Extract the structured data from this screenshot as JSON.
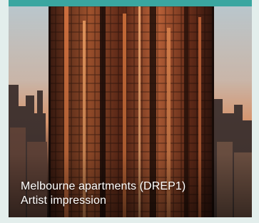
{
  "card": {
    "caption_line1": "Melbourne apartments (DREP1)",
    "caption_line2": "Artist impression",
    "image_subject": "glass-tower-building-photo"
  },
  "colors": {
    "page_background": "#e3eeec",
    "accent_bar": "#3aa6a0",
    "caption_text": "#ffffff",
    "sky_top": "#c9d2d6",
    "sky_horizon": "#f0a274",
    "tower_glass": "#7a3a22"
  }
}
